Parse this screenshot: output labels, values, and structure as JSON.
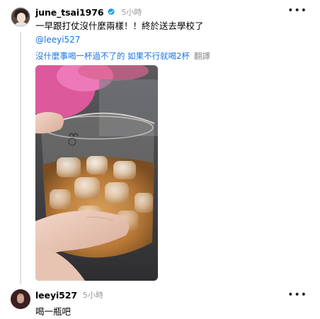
{
  "post": {
    "username": "june_tsai1976",
    "time": "5小時",
    "more_icon": "ellipsis-icon",
    "text": "一早跟打仗沒什麼兩樣！！終於送去學校了",
    "mention": "@leeyi527",
    "reply_text": "沒什麼事喝一杯過不了的 如果不行就喝2杯",
    "translate_label": "翻譯",
    "image_alt": "glass of iced drink"
  },
  "reply": {
    "username": "leeyi527",
    "time": "5小時",
    "more_icon": "ellipsis-icon",
    "text": "喝一瓶吧"
  },
  "colors": {
    "link": "#1a73e8",
    "verified": "#1d9bf0",
    "muted": "#999999"
  }
}
